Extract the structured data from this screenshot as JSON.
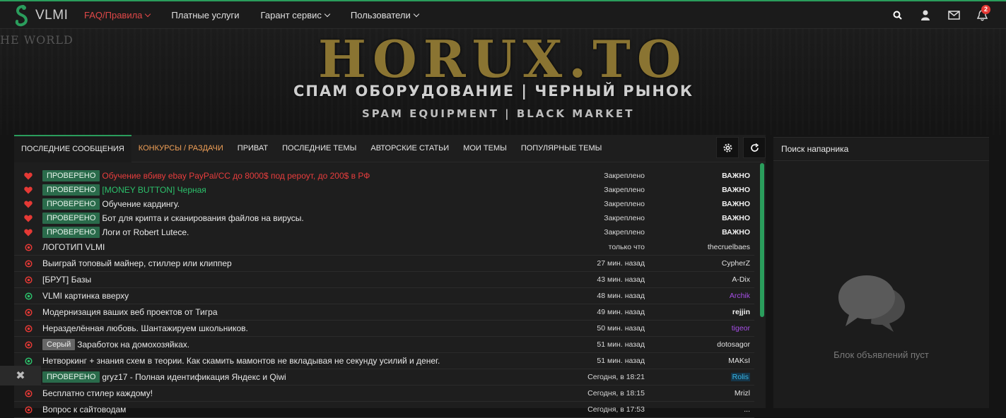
{
  "header": {
    "logo_text": "VLMI",
    "nav": [
      {
        "label": "FAQ/Правила",
        "active": true,
        "dropdown": true
      },
      {
        "label": "Платные услуги",
        "active": false,
        "dropdown": false
      },
      {
        "label": "Гарант сервис",
        "active": false,
        "dropdown": true
      },
      {
        "label": "Пользователи",
        "active": false,
        "dropdown": true
      }
    ],
    "icons": [
      "search-icon",
      "user-icon",
      "mail-icon",
      "bell-icon"
    ],
    "notification_count": "2"
  },
  "banner": {
    "world_text": "HE WORLD",
    "title": "HORUX.TO",
    "subtitle_ru": "СПАМ ОБОРУДОВАНИЕ | ЧЕРНЫЙ РЫНОК",
    "subtitle_en": "SPAM EQUIPMENT | BLACK MARKET"
  },
  "tabs": [
    {
      "label": "ПОСЛЕДНИЕ СООБЩЕНИЯ",
      "active": true
    },
    {
      "label": "КОНКУРСЫ / РАЗДАЧИ",
      "hot": true
    },
    {
      "label": "ПРИВАТ"
    },
    {
      "label": "ПОСЛЕДНИЕ ТЕМЫ"
    },
    {
      "label": "АВТОРСКИЕ СТАТЬИ"
    },
    {
      "label": "МОИ ТЕМЫ"
    },
    {
      "label": "ПОПУЛЯРНЫЕ ТЕМЫ"
    }
  ],
  "threads": [
    {
      "icon": "heart",
      "tag": "ПРОВЕРЕНО",
      "title": "Обучение вбиву ebay PayPal/CC до 8000$ под peроут, до 200$ в РФ",
      "title_style": "red",
      "time": "Закреплено",
      "author": "ВАЖНО",
      "author_style": "important"
    },
    {
      "icon": "heart",
      "tag": "ПРОВЕРЕНО",
      "title": "[MONEY BUTTON] Черная",
      "title_style": "green",
      "time": "Закреплено",
      "author": "ВАЖНО",
      "author_style": "important"
    },
    {
      "icon": "heart",
      "tag": "ПРОВЕРЕНО",
      "title": "Обучение кардингу.",
      "title_style": "",
      "time": "Закреплено",
      "author": "ВАЖНО",
      "author_style": "important"
    },
    {
      "icon": "heart",
      "tag": "ПРОВЕРЕНО",
      "title": "Бот для крипта и сканирования файлов на вирусы.",
      "title_style": "",
      "time": "Закреплено",
      "author": "ВАЖНО",
      "author_style": "important"
    },
    {
      "icon": "heart",
      "tag": "ПРОВЕРЕНО",
      "title": "Логи от Robert Lutece.",
      "title_style": "",
      "time": "Закреплено",
      "author": "ВАЖНО",
      "author_style": "important"
    },
    {
      "icon": "red-dot",
      "tag": "",
      "title": "ЛОГОТИП VLMI",
      "title_style": "",
      "time": "только что",
      "author": "thecruelbaes",
      "author_style": ""
    },
    {
      "icon": "red-dot",
      "tag": "",
      "title": "Выиграй топовый майнер, стиллер или клиппер",
      "title_style": "",
      "time": "27 мин. назад",
      "author": "CypherZ",
      "author_style": ""
    },
    {
      "icon": "red-dot",
      "tag": "",
      "title": "[БРУТ] Базы",
      "title_style": "",
      "time": "43 мин. назад",
      "author": "A-Dix",
      "author_style": ""
    },
    {
      "icon": "green-dot",
      "tag": "",
      "title": "VLMI картинка вверху",
      "title_style": "",
      "time": "48 мин. назад",
      "author": "Archik",
      "author_style": "purple"
    },
    {
      "icon": "red-dot",
      "tag": "",
      "title": "Модернизация ваших веб проектов от Тигра",
      "title_style": "",
      "time": "49 мин. назад",
      "author": "rejjin",
      "author_style": "bold"
    },
    {
      "icon": "red-dot",
      "tag": "",
      "title": "Неразделённая любовь. Шантажируем школьников.",
      "title_style": "",
      "time": "50 мин. назад",
      "author": "tigeor",
      "author_style": "purple"
    },
    {
      "icon": "red-dot",
      "tag": "Серый",
      "tag_style": "gray",
      "title": "Заработок на домохозяйках.",
      "title_style": "",
      "time": "51 мин. назад",
      "author": "dotosagor",
      "author_style": ""
    },
    {
      "icon": "green-dot",
      "tag": "",
      "title": "Нетворкинг + знания схем в теории. Как скамить мамонтов не вкладывая не секунду усилий и денег.",
      "title_style": "",
      "time": "51 мин. назад",
      "author": "MAKsI",
      "author_style": ""
    },
    {
      "icon": "none",
      "tag": "ПРОВЕРЕНО",
      "title": "gryz17 - Полная идентификация Яндекс и Qiwi",
      "title_style": "",
      "time": "Сегодня, в 18:21",
      "author": "Rolis",
      "author_style": "cyan"
    },
    {
      "icon": "red-dot",
      "tag": "",
      "title": "Бесплатно стилер каждому!",
      "title_style": "",
      "time": "Сегодня, в 18:15",
      "author": "Mrizl",
      "author_style": ""
    },
    {
      "icon": "red-dot",
      "tag": "",
      "title": "Вопрос к сайтоводам",
      "title_style": "",
      "time": "Сегодня, в 17:53",
      "author": "...",
      "author_style": ""
    }
  ],
  "sidebar": {
    "title": "Поиск напарника",
    "empty_text": "Блок объявлений пуст"
  },
  "colors": {
    "accent": "#2a9d5c",
    "danger": "#e83d3d",
    "verified_tag": "#2a6b4b"
  }
}
